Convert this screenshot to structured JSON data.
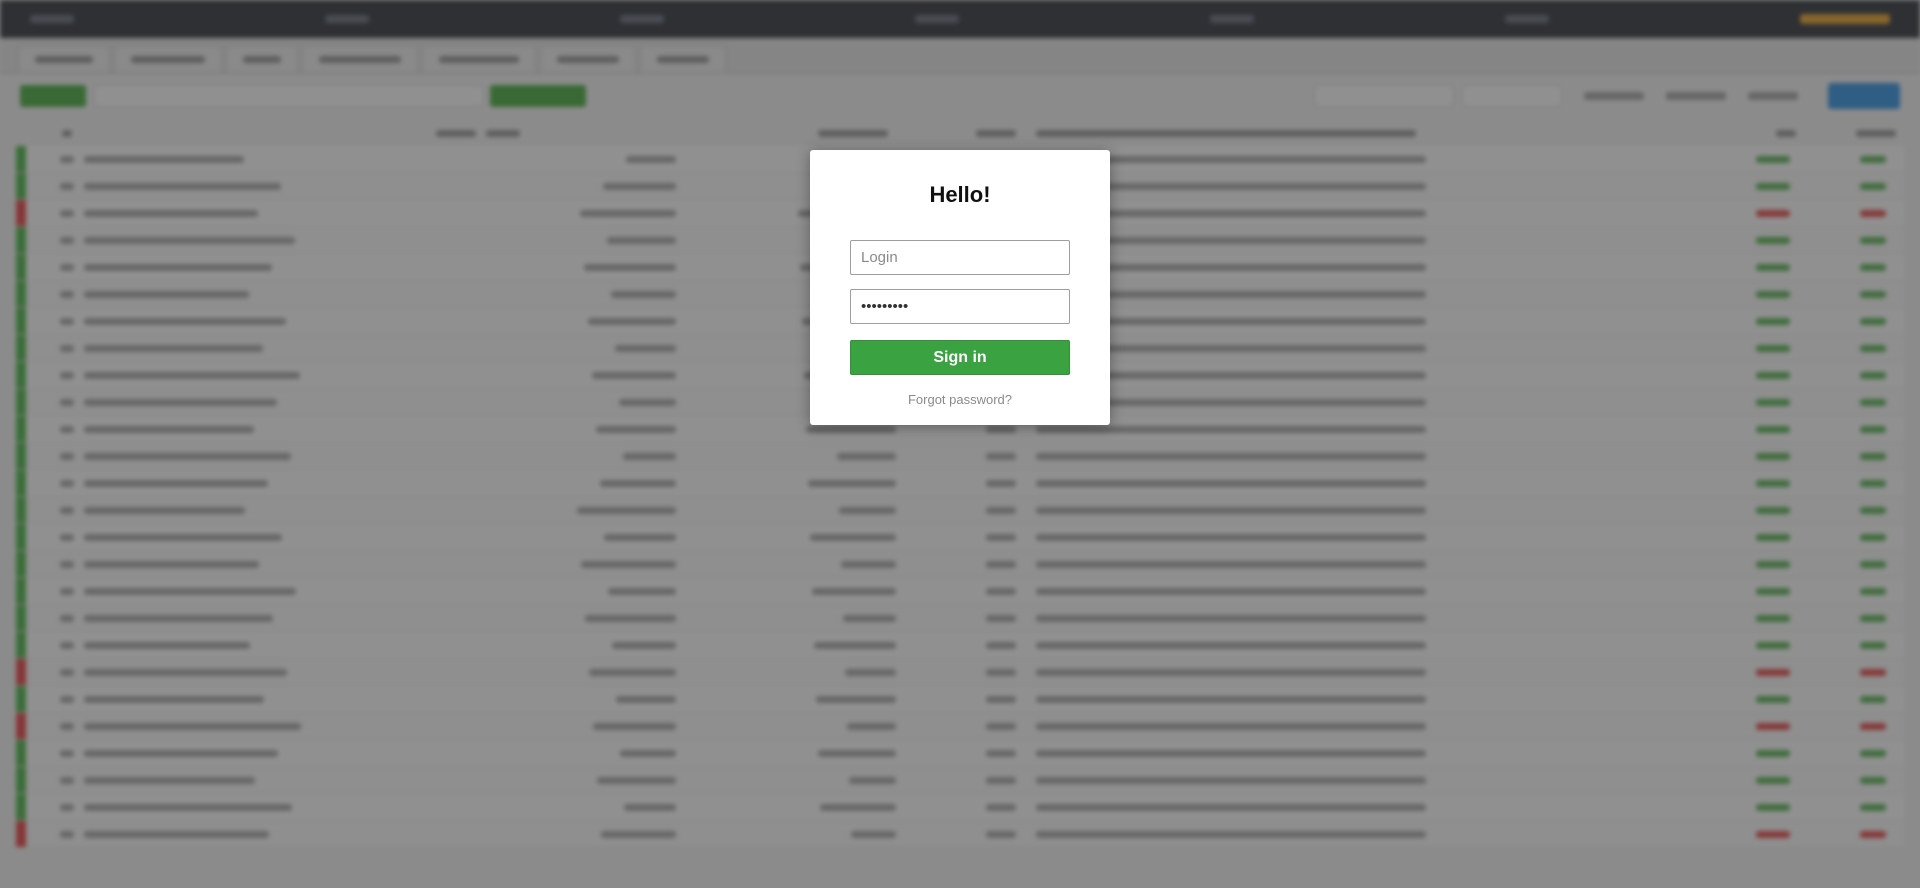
{
  "modal": {
    "title": "Hello!",
    "login_placeholder": "Login",
    "password_value": "•••••••••",
    "signin_label": "Sign in",
    "forgot_label": "Forgot password?"
  },
  "colors": {
    "signin_green": "#3aa241",
    "overlay": "#3c3c3c",
    "background": "#ececec"
  }
}
